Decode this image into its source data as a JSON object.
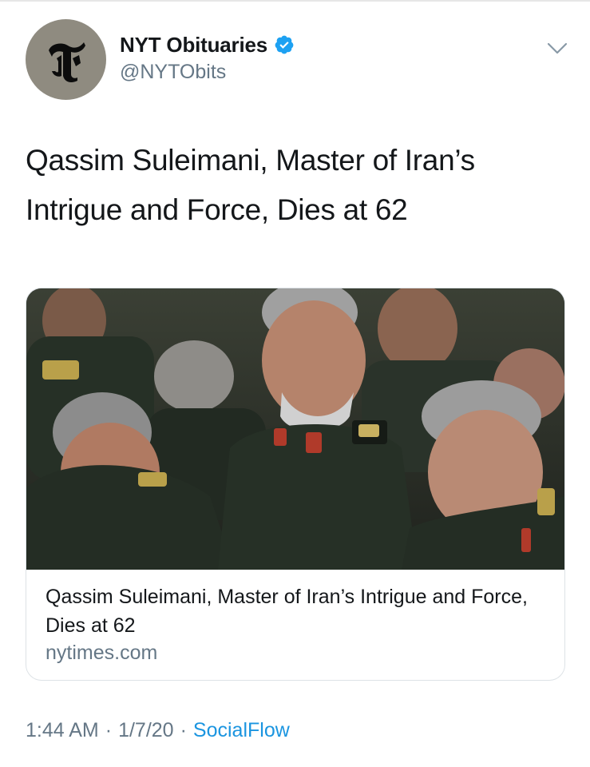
{
  "account": {
    "display_name": "NYT Obituaries",
    "handle": "@NYTObits",
    "verified": true,
    "avatar_icon": "nyt-t-logo-icon",
    "avatar_color": "#8f8b80"
  },
  "tweet": {
    "text": "Qassim Suleimani, Master of Iran’s Intrigue and Force, Dies at 62"
  },
  "card": {
    "image_icon": "news-photo",
    "title": "Qassim Suleimani, Master of Iran’s Intrigue and Force, Dies at 62",
    "domain": "nytimes.com"
  },
  "meta": {
    "time": "1:44 AM",
    "separator": "·",
    "date": "1/7/20",
    "source": "SocialFlow"
  },
  "colors": {
    "verified_blue": "#1da1f2",
    "link_blue": "#1b95e0",
    "secondary_text": "#657786"
  }
}
